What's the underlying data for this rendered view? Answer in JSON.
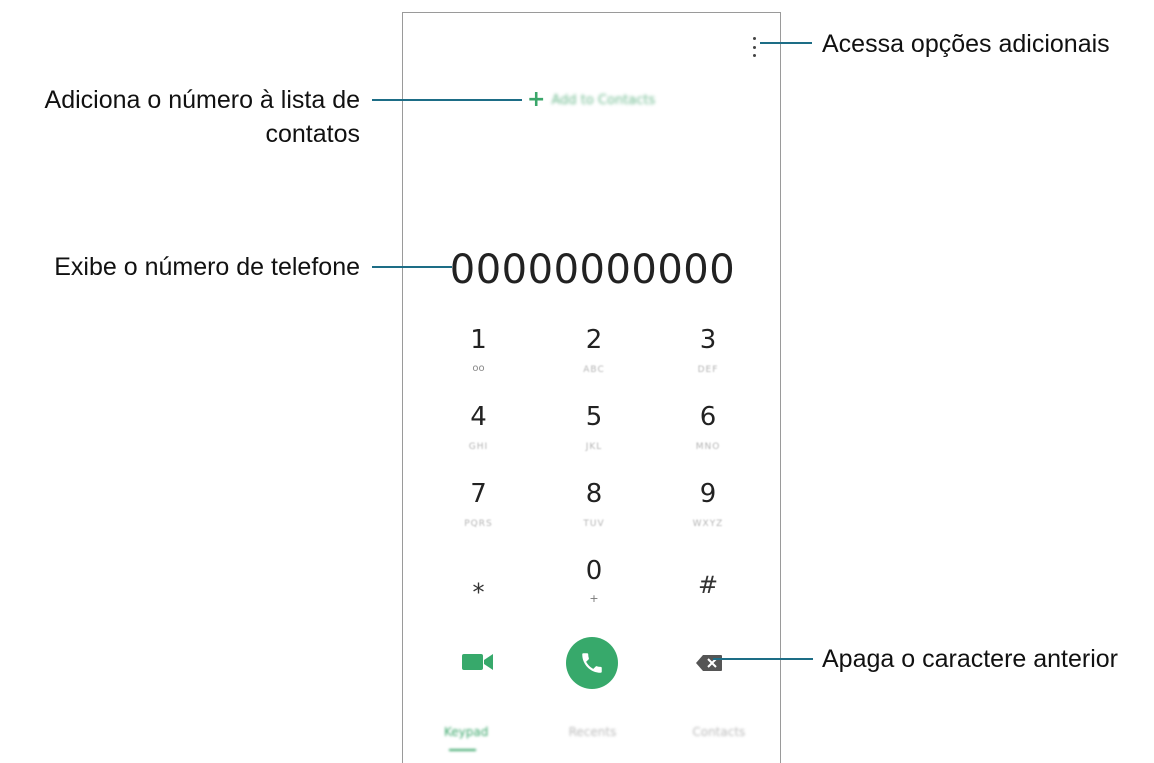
{
  "phone": {
    "add_to_contacts_label": "Add to Contacts",
    "number": "00000000000",
    "keys": [
      {
        "digit": "1",
        "sub": "oo"
      },
      {
        "digit": "2",
        "sub": "ABC"
      },
      {
        "digit": "3",
        "sub": "DEF"
      },
      {
        "digit": "4",
        "sub": "GHI"
      },
      {
        "digit": "5",
        "sub": "JKL"
      },
      {
        "digit": "6",
        "sub": "MNO"
      },
      {
        "digit": "7",
        "sub": "PQRS"
      },
      {
        "digit": "8",
        "sub": "TUV"
      },
      {
        "digit": "9",
        "sub": "WXYZ"
      },
      {
        "digit": "⁎",
        "sub": ""
      },
      {
        "digit": "0",
        "sub": "+"
      },
      {
        "digit": "#",
        "sub": ""
      }
    ],
    "tabs": [
      {
        "label": "Keypad",
        "active": true
      },
      {
        "label": "Recents",
        "active": false
      },
      {
        "label": "Contacts",
        "active": false
      }
    ],
    "accent_color": "#37a96b"
  },
  "callouts": {
    "more_options": "Acessa opções adicionais",
    "add_contact_line1": "Adiciona o número à lista de",
    "add_contact_line2": "contatos",
    "display_number": "Exibe o número de telefone",
    "delete_char": "Apaga o caractere anterior"
  }
}
